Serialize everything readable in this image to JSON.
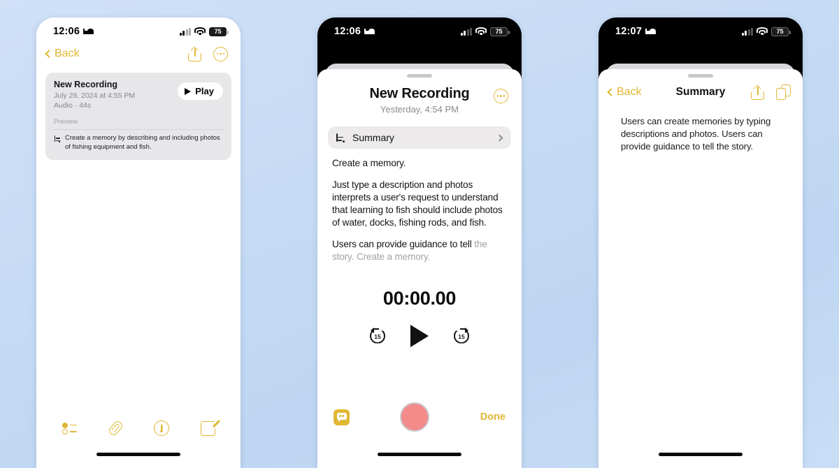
{
  "theme": {
    "accent_yellow": "#e0b732",
    "background_blue": "#c6dbf4",
    "record_red": "#f48b8b",
    "card_gray": "#e7e7e9"
  },
  "phone1": {
    "status": {
      "time": "12:06",
      "sleep_icon": "bed-icon",
      "signal_icon": "cellular-bars-icon",
      "wifi_icon": "wifi-icon",
      "battery": "75"
    },
    "nav": {
      "back_label": "Back",
      "share_icon": "share-icon",
      "more_icon": "more-circle-icon"
    },
    "card": {
      "title": "New Recording",
      "date": "July 29, 2024 at 4:55 PM",
      "meta": "Audio · 44s",
      "play_label": "Play",
      "preview_label": "Preview",
      "preview_icon": "summarize-icon",
      "preview_text": "Create a memory by describing and including photos of fishing equipment and fish."
    },
    "toolbar": {
      "checklist_icon": "checklist-icon",
      "attach_icon": "paperclip-icon",
      "markup_icon": "markup-pen-icon",
      "compose_icon": "compose-icon"
    }
  },
  "phone2": {
    "status": {
      "time": "12:06",
      "sleep_icon": "bed-icon",
      "signal_icon": "cellular-bars-icon",
      "wifi_icon": "wifi-icon",
      "battery": "75"
    },
    "header": {
      "title": "New Recording",
      "subtitle": "Yesterday, 4:54 PM",
      "more_icon": "more-circle-icon",
      "grabber_icon": "sheet-grabber-icon"
    },
    "summary_row": {
      "label": "Summary",
      "icon": "summarize-icon",
      "chevron_icon": "chevron-right-icon"
    },
    "transcript": [
      {
        "text": "Create a memory.",
        "dim": false
      },
      {
        "text": "Just type a description and photos interprets a user's request to understand that learning to fish should include photos of water, docks, fishing rods, and fish.",
        "dim": false
      },
      {
        "text": "Users can provide guidance to tell",
        "dim": false
      },
      {
        "text": "the story. Create a memory.",
        "dim": true
      }
    ],
    "player": {
      "timer": "00:00.00",
      "skip_back_label": "15",
      "skip_forward_label": "15",
      "play_icon": "play-icon",
      "skip_back_icon": "skip-back-15-icon",
      "skip_forward_icon": "skip-forward-15-icon"
    },
    "bottom": {
      "transcript_icon": "transcript-bubble-icon",
      "record_icon": "record-button-icon",
      "done_label": "Done"
    }
  },
  "phone3": {
    "status": {
      "time": "12:07",
      "sleep_icon": "bed-icon",
      "signal_icon": "cellular-bars-icon",
      "wifi_icon": "wifi-icon",
      "battery": "75"
    },
    "nav": {
      "back_label": "Back",
      "title": "Summary",
      "share_icon": "share-icon",
      "copy_icon": "copy-icon",
      "grabber_icon": "sheet-grabber-icon"
    },
    "body": {
      "text": "Users can create memories by typing descriptions and photos. Users can provide guidance to tell the story."
    }
  }
}
